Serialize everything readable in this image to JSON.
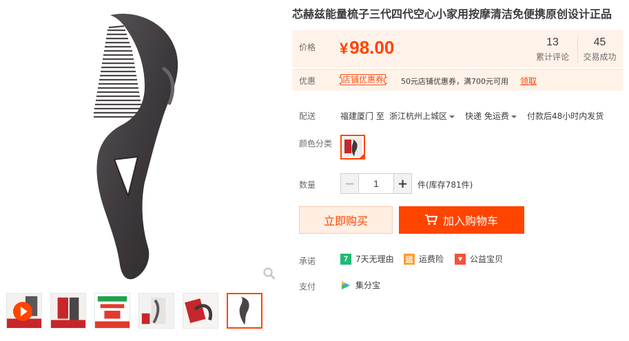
{
  "product": {
    "title": "芯赫兹能量梳子三代四代空心小家用按摩清洁免便携原创设计正品"
  },
  "price": {
    "label": "价格",
    "currency": "¥",
    "amount": "98.00",
    "reviews_count": "13",
    "reviews_label": "累计评论",
    "deals_count": "45",
    "deals_label": "交易成功"
  },
  "coupon": {
    "label": "优惠",
    "tag": "店铺优惠券",
    "text": "50元店铺优惠券，满700元可用",
    "link": "领取"
  },
  "shipping": {
    "label": "配送",
    "origin": "福建厦门 至",
    "destination": "浙江杭州上城区",
    "method": "快递 免运费",
    "promise": "付款后48小时内发货"
  },
  "variant": {
    "label": "颜色分类"
  },
  "quantity": {
    "label": "数量",
    "value": "1",
    "stock": "件(库存781件)"
  },
  "actions": {
    "buy_now": "立即购买",
    "add_to_cart": "加入购物车"
  },
  "promises": {
    "label": "承诺",
    "items": [
      {
        "icon": "seven-day-icon",
        "glyph": "7",
        "text": "7天无理由"
      },
      {
        "icon": "shipping-insurance-icon",
        "glyph": "运",
        "text": "运费险"
      },
      {
        "icon": "charity-icon",
        "glyph": "♥",
        "text": "公益宝贝"
      }
    ]
  },
  "payment": {
    "label": "支付",
    "method": "集分宝"
  },
  "colors": {
    "accent": "#ff4400",
    "price_bg": "#fff2e8",
    "buy_bg": "#ffeee2"
  }
}
